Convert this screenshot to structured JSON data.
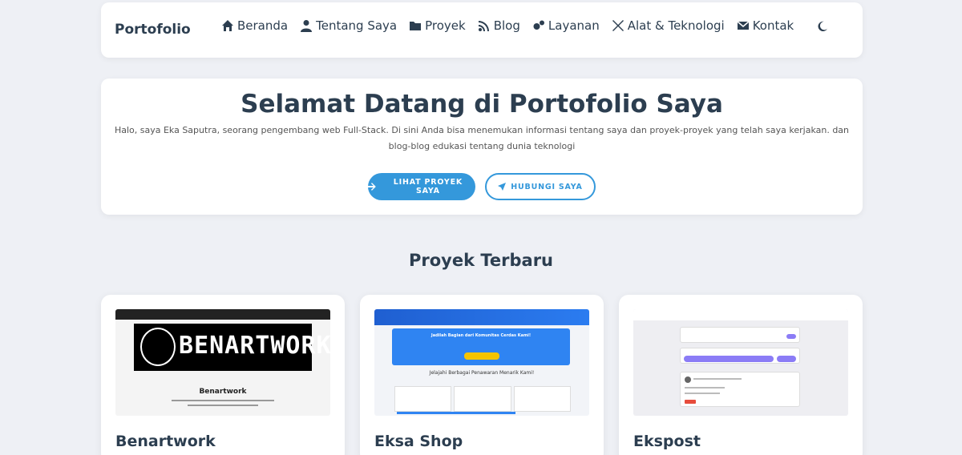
{
  "nav": {
    "brand": "Portofolio",
    "items": [
      {
        "label": "Beranda",
        "icon": "home-icon"
      },
      {
        "label": "Tentang Saya",
        "icon": "user-icon"
      },
      {
        "label": "Proyek",
        "icon": "folder-icon"
      },
      {
        "label": "Blog",
        "icon": "rss-icon"
      },
      {
        "label": "Layanan",
        "icon": "cogs-icon"
      },
      {
        "label": "Alat & Teknologi",
        "icon": "tools-icon"
      },
      {
        "label": "Kontak",
        "icon": "envelope-icon"
      }
    ],
    "theme_icon": "moon-icon"
  },
  "hero": {
    "title": "Selamat Datang di Portofolio Saya",
    "description_line1": "Halo, saya Eka Saputra, seorang pengembang web Full-Stack. Di sini Anda bisa menemukan informasi tentang saya dan proyek-proyek yang telah saya kerjakan. dan",
    "description_line2": "blog-blog edukasi tentang dunia teknologi",
    "primary_button": "LIHAT PROYEK SAYA",
    "secondary_button": "HUBUNGI SAYA"
  },
  "projects": {
    "section_title": "Proyek Terbaru",
    "items": [
      {
        "title": "Benartwork",
        "thumb_logo": "BENARTWORK",
        "thumb_heading": "Benartwork"
      },
      {
        "title": "Eksa Shop",
        "thumb_heading": "Jadilah Bagian dari Komunitas Cerdas Kami!",
        "thumb_subheading": "Jelajahi Berbagai Penawaran Menarik Kami!"
      },
      {
        "title": "Ekspost"
      }
    ]
  },
  "colors": {
    "accent": "#3498db",
    "text": "#2c3e50",
    "background": "#eef0f5"
  }
}
